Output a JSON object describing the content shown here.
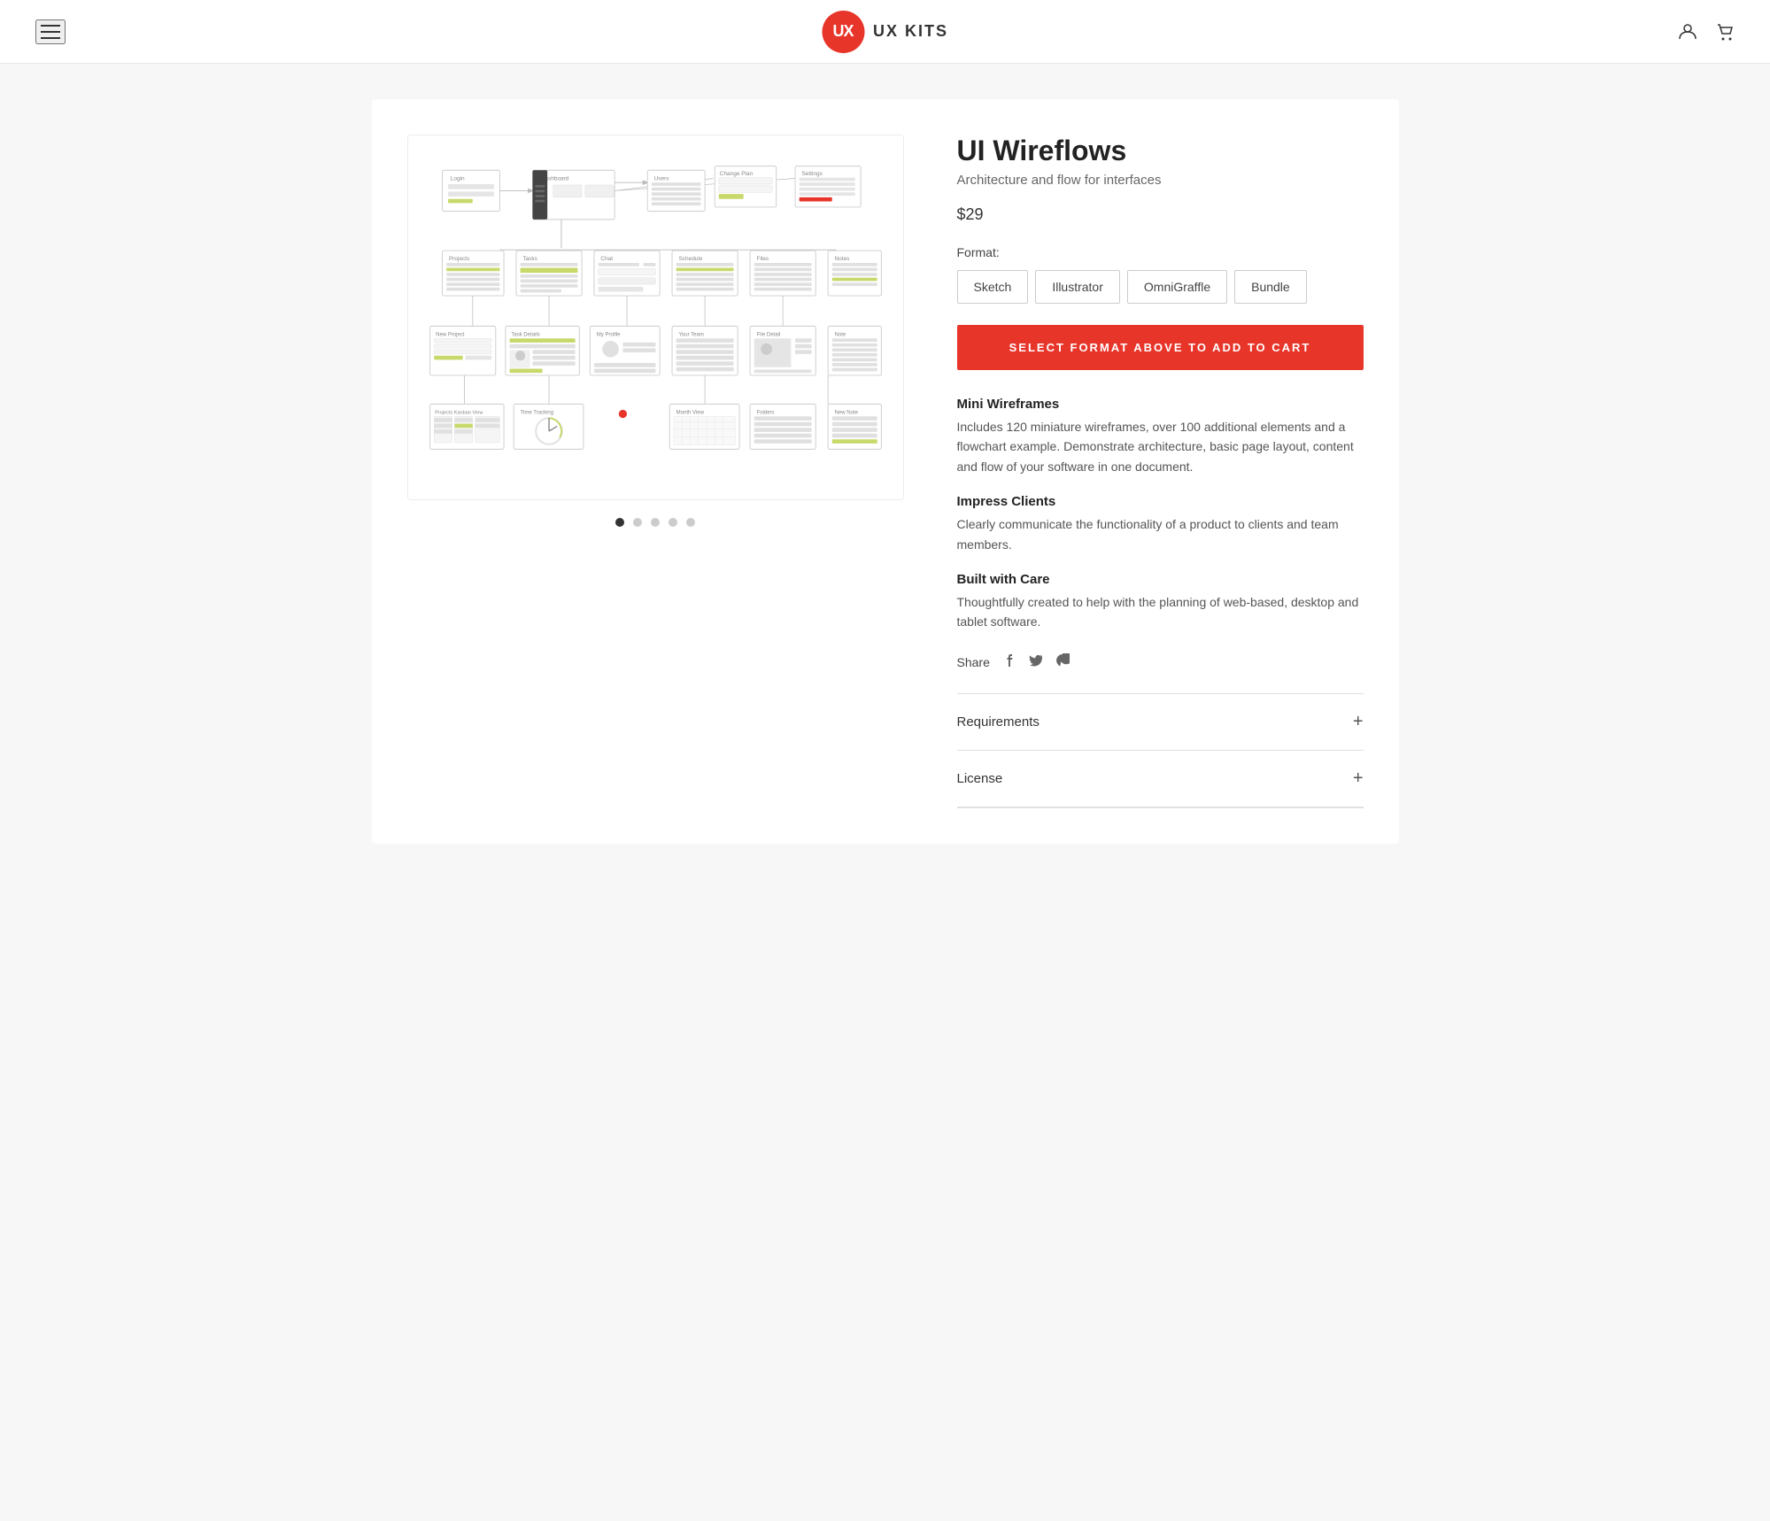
{
  "header": {
    "logo_text": "UX KITS",
    "logo_initials": "UX"
  },
  "product": {
    "title": "UI Wireflows",
    "subtitle": "Architecture and flow for interfaces",
    "price": "$29",
    "format_label": "Format:",
    "formats": [
      "Sketch",
      "Illustrator",
      "OmniGraffle",
      "Bundle"
    ],
    "add_to_cart_label": "SELECT FORMAT ABOVE TO ADD TO CART",
    "features": [
      {
        "title": "Mini Wireframes",
        "description": "Includes 120 miniature wireframes, over 100 additional elements and a flowchart example. Demonstrate architecture, basic page layout, content and flow of your software in one document."
      },
      {
        "title": "Impress Clients",
        "description": "Clearly communicate the functionality of a product to clients and team members."
      },
      {
        "title": "Built with Care",
        "description": "Thoughtfully created to help with the planning of web-based, desktop and tablet software."
      }
    ],
    "share_label": "Share",
    "accordion_items": [
      {
        "label": "Requirements"
      },
      {
        "label": "License"
      }
    ]
  },
  "image_dots": [
    {
      "active": true
    },
    {
      "active": false
    },
    {
      "active": false
    },
    {
      "active": false
    },
    {
      "active": false
    }
  ]
}
